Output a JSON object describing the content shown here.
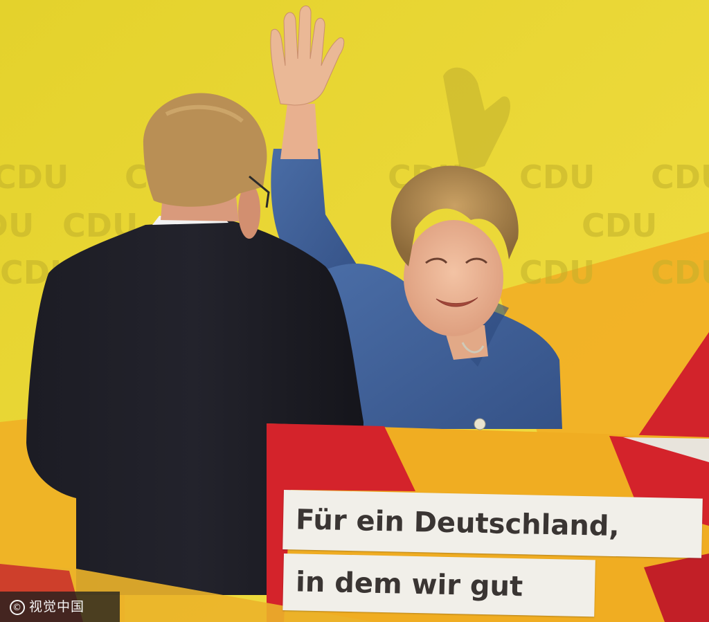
{
  "backdrop": {
    "logo_text": "CDU",
    "colors": {
      "yellow": "#e8d42e",
      "orange": "#f0ad22",
      "red": "#d6242c"
    }
  },
  "sign": {
    "line1": "Für ein Deutschland,",
    "line2": "in dem wir gut"
  },
  "watermark": {
    "symbol": "©",
    "text": "视觉中国"
  }
}
